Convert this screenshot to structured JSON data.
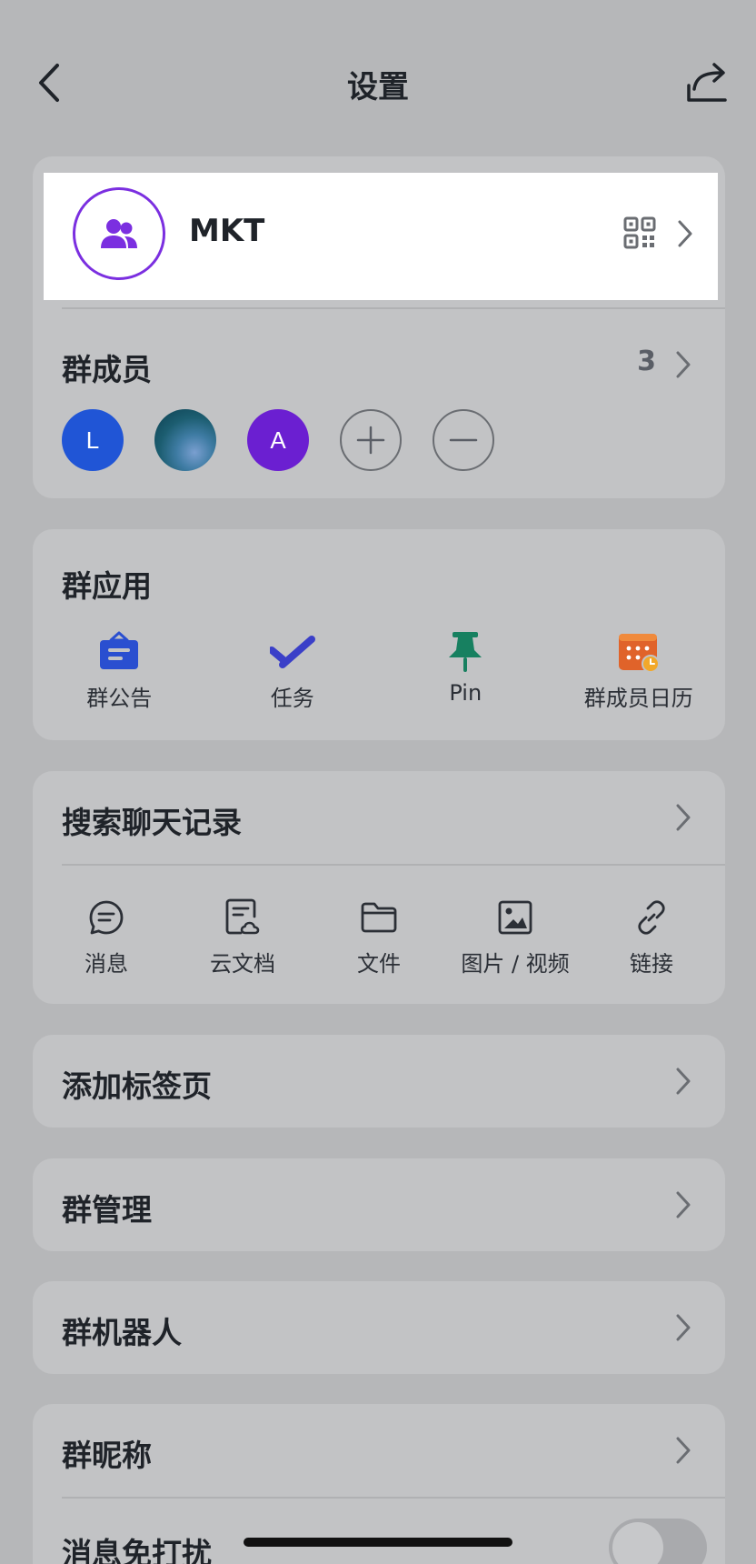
{
  "header": {
    "title": "设置"
  },
  "group": {
    "name": "MKT"
  },
  "members": {
    "title": "群成员",
    "count": "3",
    "avatars": [
      {
        "initial": "L",
        "color": "#2055d6"
      },
      {
        "initial": "",
        "color": "#1c5d70"
      },
      {
        "initial": "A",
        "color": "#6b1fd1"
      }
    ]
  },
  "apps": {
    "title": "群应用",
    "items": [
      {
        "label": "群公告",
        "icon": "announcement-icon",
        "color": "#2a4fd0"
      },
      {
        "label": "任务",
        "icon": "task-check-icon",
        "color": "#3a3fc8"
      },
      {
        "label": "Pin",
        "icon": "pin-icon",
        "color": "#178060"
      },
      {
        "label": "群成员日历",
        "icon": "calendar-icon",
        "color": "#e0632a"
      }
    ]
  },
  "search": {
    "title": "搜索聊天记录",
    "tools": [
      {
        "label": "消息",
        "icon": "message-icon"
      },
      {
        "label": "云文档",
        "icon": "cloud-doc-icon"
      },
      {
        "label": "文件",
        "icon": "folder-icon"
      },
      {
        "label": "图片 / 视频",
        "icon": "image-icon"
      },
      {
        "label": "链接",
        "icon": "link-icon"
      }
    ]
  },
  "rows": {
    "add_tab": "添加标签页",
    "manage": "群管理",
    "bots": "群机器人",
    "nickname": "群昵称",
    "mute": "消息免打扰"
  },
  "toggles": {
    "mute_on": false
  }
}
